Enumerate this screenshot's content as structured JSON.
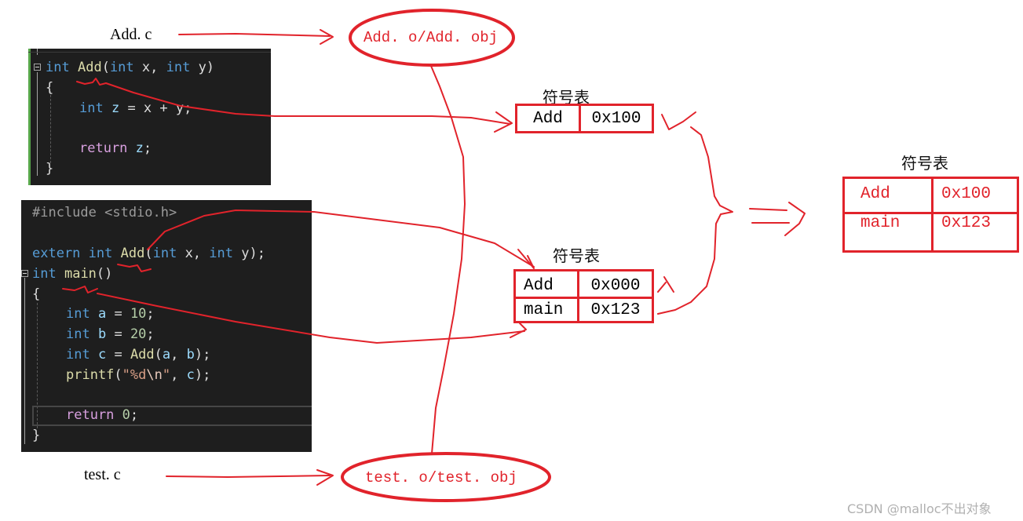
{
  "files": {
    "add_c": "Add. c",
    "test_c": "test. c",
    "add_obj": "Add. o/Add. obj",
    "test_obj": "test. o/test. obj"
  },
  "add_code": {
    "lines": [
      {
        "kw": "int",
        "fn": "Add",
        "rest_open": "(",
        "p1kw": "int",
        "p1": " x, ",
        "p2kw": "int",
        "p2": " y)"
      },
      {
        "text": "{"
      },
      {
        "kw": "int",
        "var": "z",
        "rest": " = x + y;"
      },
      {
        "text": ""
      },
      {
        "ctl": "return",
        "var": "z",
        "rest": ";"
      },
      {
        "text": "}"
      }
    ]
  },
  "test_code": {
    "include": "#include <stdio.h>",
    "extern_kw": "extern",
    "int_kw": "int",
    "add_fn": "Add",
    "main_fn": "main",
    "return_kw": "return",
    "printf_fn": "printf",
    "lines_text": {
      "extern_rest_1": "(",
      "extern_p": " x, ",
      "extern_end": " y);",
      "main_parens": "()",
      "open_brace": "{",
      "a_var": "a",
      "a_val": "10",
      "b_var": "b",
      "b_val": "20",
      "c_var": "c",
      "call_a": "a",
      "call_b": "b",
      "fmt_str": "\"%d",
      "fmt_esc": "\\n",
      "fmt_end": "\"",
      "ret_val": "0",
      "close_brace": "}"
    }
  },
  "symbol_tables": {
    "title": "符号表",
    "add_obj_table": [
      [
        "Add",
        "0x100"
      ]
    ],
    "test_obj_table": [
      [
        "Add",
        "0x000"
      ],
      [
        "main",
        "0x123"
      ]
    ],
    "merged_table": [
      [
        "Add",
        "0x100"
      ],
      [
        "main",
        "0x123"
      ]
    ]
  },
  "marks": {
    "valid": "check-mark",
    "invalid": "cross-mark"
  },
  "colors": {
    "annotation_red": "#e1232b",
    "editor_bg": "#1e1e1e",
    "keyword_blue": "#569cd6",
    "function_yellow": "#dcdcaa"
  },
  "watermark": "CSDN @malloc不出对象"
}
